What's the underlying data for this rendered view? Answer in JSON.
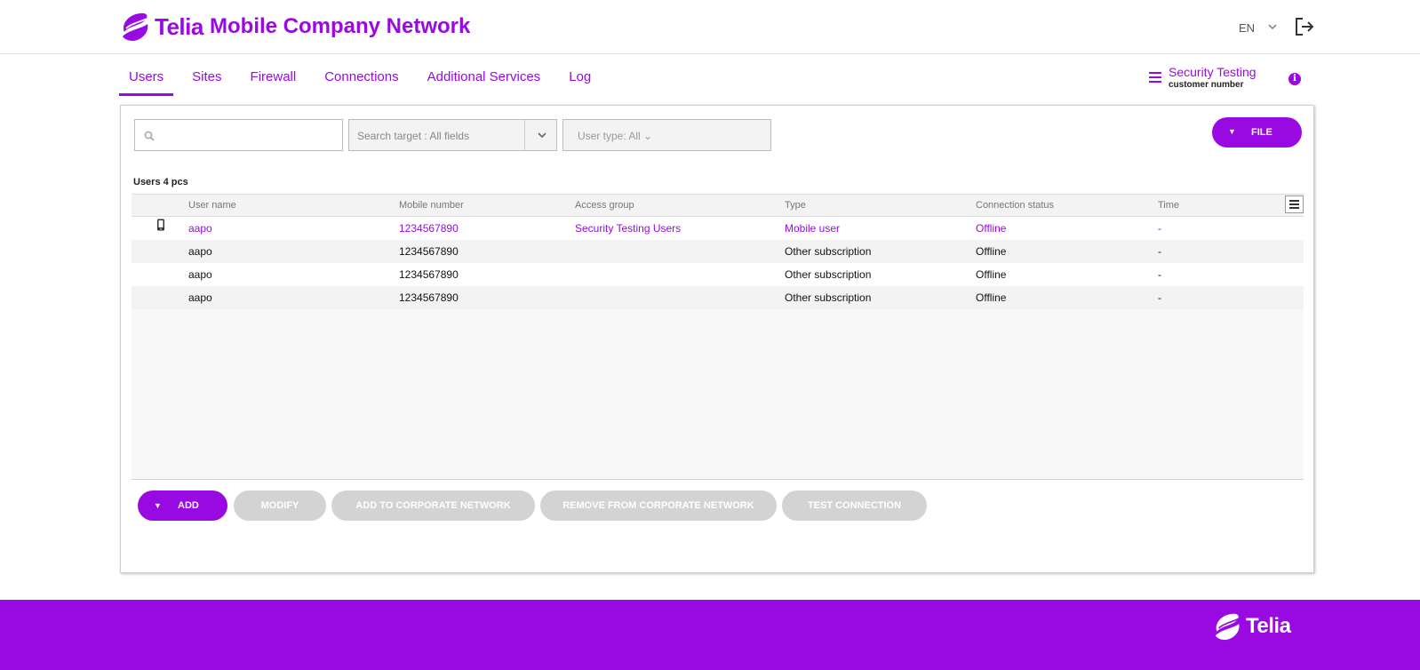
{
  "header": {
    "brand": "Telia",
    "title": "Mobile Company Network",
    "language": "EN",
    "icons": {
      "logo": "telia-logo-icon",
      "lang_chevron": "chevron-down-icon",
      "logout": "logout-icon"
    }
  },
  "tabs": [
    {
      "label": "Users",
      "active": true
    },
    {
      "label": "Sites",
      "active": false
    },
    {
      "label": "Firewall",
      "active": false
    },
    {
      "label": "Connections",
      "active": false
    },
    {
      "label": "Additional Services",
      "active": false
    },
    {
      "label": "Log",
      "active": false
    }
  ],
  "account": {
    "name": "Security Testing",
    "subtitle": "customer number",
    "icon": "hamburger-icon",
    "info_icon": "info-icon"
  },
  "toolbar": {
    "search_placeholder": "",
    "search_target": "Search target : All fields",
    "user_type": "User type: All ⌄",
    "file_label": "FILE"
  },
  "users": {
    "count_label": "Users 4 pcs",
    "columns": [
      "User name",
      "Mobile number",
      "Access group",
      "Type",
      "Connection status",
      "Time"
    ],
    "rows": [
      {
        "icon": "mobile-phone-icon",
        "user_name": "aapo",
        "mobile_number": "1234567890",
        "access_group": "Security Testing Users",
        "type": "Mobile user",
        "connection_status": "Offline",
        "time": "-"
      },
      {
        "icon": "",
        "user_name": "aapo",
        "mobile_number": "1234567890",
        "access_group": "",
        "type": "Other subscription",
        "connection_status": "Offline",
        "time": "-"
      },
      {
        "icon": "",
        "user_name": "aapo",
        "mobile_number": "1234567890",
        "access_group": "",
        "type": "Other subscription",
        "connection_status": "Offline",
        "time": "-"
      },
      {
        "icon": "",
        "user_name": "aapo",
        "mobile_number": "1234567890",
        "access_group": "",
        "type": "Other subscription",
        "connection_status": "Offline",
        "time": "-"
      }
    ]
  },
  "actions": {
    "add": "ADD",
    "modify": "MODIFY",
    "add_to_network": "ADD TO CORPORATE NETWORK",
    "remove_from_network": "REMOVE FROM CORPORATE NETWORK",
    "test_connection": "TEST CONNECTION"
  },
  "footer": {
    "brand": "Telia"
  },
  "colors": {
    "accent": "#990ae3",
    "disabled": "#d3d3d3"
  }
}
